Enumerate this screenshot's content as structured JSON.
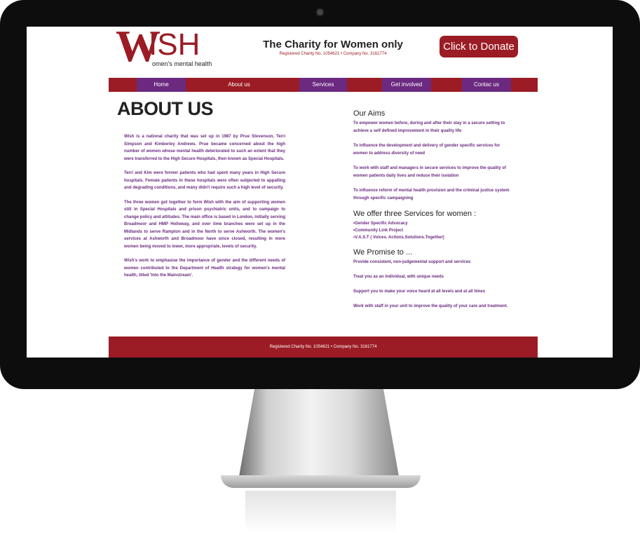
{
  "logo": {
    "w": "W",
    "ish": "ISH",
    "subtitle": "omen's mental health"
  },
  "tagline": {
    "title": "The Charity for Women only",
    "registration": "Registered Charity No. 1054621 • Company No. 3161774"
  },
  "donate_label": "Click to Donate",
  "nav": [
    "Home",
    "About us",
    "Services",
    "Get involved",
    "Contac us"
  ],
  "page_title": "ABOUT US",
  "about": [
    "Wish is a national charity that was set up in 1987 by Prue Stevenson, Terri Simpson and Kimberley Andrews. Prue became concerned about the high number of women whose mental health deteriorated to such an extent that they were transferred to the High Secure Hospitals, then known as Special Hospitals.",
    "Terri and Kim were former patients who had spent many years in High Secure hospitals. Female patients in these hospitals were often subjected to appalling and degrading conditions, and many didn't require such a high level of security.",
    "The three women got together to form Wish with the aim of supporting women still in Special Hospitals and prison psychiatric units, and to campaign to change policy and attitudes. The main office is  based in London, initially serving Broadmoor and HMP Holloway, and over time branches were set up in the Midlands to serve Rampton and in the North to serve Ashworth. The women's services at Ashworth and Broadmoor have since closed, resulting in more women being moved to lower, more appropriate, levels of security.",
    "Wish's work to emphasise the importance of gender and the different needs of women contributed to the Department of Health strategy for women's mental health, titled 'Into the Mainstream'."
  ],
  "aims": {
    "heading": "Our Aims",
    "items": [
      "To empower women before, during and after their stay in a secure setting to achieve a self defined improvement in their quality life",
      "To influence the development and delivery of gender specific services for women to address diversity of need",
      "To work with staff and managers in secure services to improve the quality of women patients daily lives and reduce their isolation",
      "To influence reform of mental health provision and the criminal justice system through specific campaigning"
    ]
  },
  "services": {
    "heading": "We offer three Services for women :",
    "items": [
      "•Gender Specific Advocacy",
      "•Community Link Project",
      "•V.A.S.T ( Voices. Actions.Solutions.Together)"
    ]
  },
  "promise": {
    "heading": "We Promise to ...",
    "items": [
      "Provide consistent, non-judgemental support and services",
      "Treat you as an individual, with unique needs",
      "Support you to make your voice heard at all levels and at all times",
      "Work with staff in your unit to improve the quality of your care and treatment."
    ]
  },
  "footer": "Registered Charity No. 1054621 • Company No. 3161774",
  "colors": {
    "brand_red": "#9b1c24",
    "brand_purple": "#6b2a80"
  }
}
